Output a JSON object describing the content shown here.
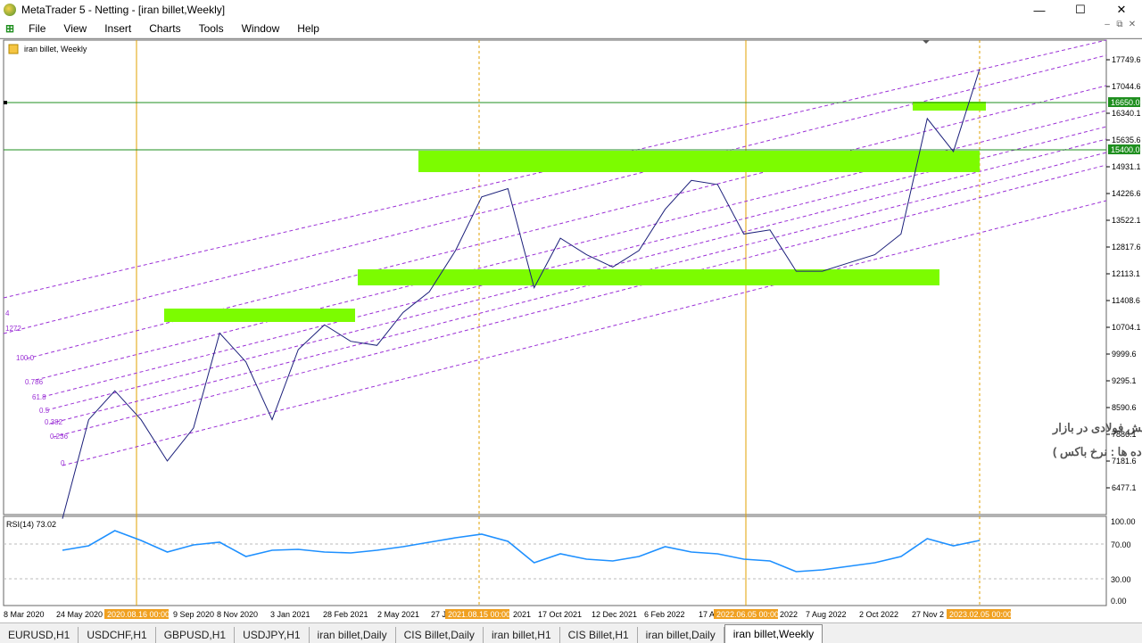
{
  "window": {
    "title": "MetaTrader 5 - Netting - [iran billet,Weekly]",
    "min": "—",
    "max": "☐",
    "close": "✕"
  },
  "menu": [
    "File",
    "View",
    "Insert",
    "Charts",
    "Tools",
    "Window",
    "Help"
  ],
  "chart": {
    "label": "iran billet, Weekly",
    "price_axis": [
      "17749.6",
      "17044.6",
      "16340.1",
      "15635.6",
      "14931.1",
      "14226.6",
      "13522.1",
      "12817.6",
      "12113.1",
      "11408.6",
      "10704.1",
      "9999.6",
      "9295.1",
      "8590.6",
      "7886.1",
      "7181.6",
      "6477.1"
    ],
    "hline_labels": [
      "16650.0",
      "15400.0"
    ],
    "fib_labels": [
      "4",
      "1272",
      "100.0",
      "0.786",
      "61.8",
      "0.5",
      "0.382",
      "0.236",
      "0"
    ],
    "annotation_line1": "نمودار تغییرات نرخ شمش فولادی در بازار",
    "annotation_line2": "گزارشگر بازار فولاد ( داده ها : نرخ باکس )",
    "rsi_label": "RSI(14) 73.02",
    "rsi_axis": [
      "100.00",
      "70.00",
      "30.00",
      "0.00"
    ],
    "time_axis": [
      "8 Mar 2020",
      "24 May 2020",
      "9 Sep 2020",
      "8 Nov 2020",
      "3 Jan 2021",
      "28 Feb 2021",
      "2 May 2021",
      "27 J",
      "2021",
      "17 Oct 2021",
      "12 Dec 2021",
      "6 Feb 2022",
      "17 A",
      "2022",
      "7 Aug 2022",
      "2 Oct 2022",
      "27 Nov 2"
    ],
    "time_markers": [
      "2020.08.16 00:00",
      "2021.08.15 00:00",
      "2022.06.05 00:00",
      "2023.02.05 00:00"
    ],
    "colors": {
      "price_line": "#1b1f7a",
      "zone": "#7cfc00",
      "rsi": "#1e90ff",
      "hline": "#1f8f1f",
      "fib": "#9b30d6",
      "vline": "#e0a000"
    }
  },
  "chart_data": {
    "type": "line",
    "title": "نمودار تغییرات نرخ شمش فولادی در بازار",
    "x": [
      "2020-03",
      "2020-04",
      "2020-05",
      "2020-06",
      "2020-07",
      "2020-08",
      "2020-09",
      "2020-10",
      "2020-11",
      "2020-12",
      "2021-01",
      "2021-02",
      "2021-03",
      "2021-04",
      "2021-05",
      "2021-06",
      "2021-07",
      "2021-08",
      "2021-09",
      "2021-10",
      "2021-11",
      "2021-12",
      "2022-01",
      "2022-02",
      "2022-03",
      "2022-04",
      "2022-05",
      "2022-06",
      "2022-07",
      "2022-08",
      "2022-09",
      "2022-10",
      "2022-11",
      "2022-12",
      "2023-01",
      "2023-02"
    ],
    "series": [
      {
        "values": [
          6300,
          8700,
          9400,
          8700,
          7700,
          8500,
          10800,
          10100,
          8700,
          10400,
          11000,
          10600,
          10500,
          11300,
          11800,
          12800,
          14100,
          14300,
          11900,
          13100,
          12700,
          12400,
          12800,
          13800,
          14500,
          14400,
          13200,
          13300,
          12300,
          12300,
          12500,
          12700,
          13200,
          16000,
          15200,
          17200
        ]
      }
    ],
    "rsi": [
      62,
      67,
      84,
      73,
      60,
      68,
      71,
      55,
      62,
      63,
      60,
      59,
      62,
      66,
      71,
      76,
      80,
      72,
      48,
      58,
      52,
      50,
      55,
      66,
      60,
      58,
      52,
      50,
      38,
      40,
      44,
      48,
      55,
      75,
      67,
      73
    ],
    "ylim": [
      6400,
      17900
    ],
    "hlines": [
      16650.0,
      15400.0
    ]
  }
}
